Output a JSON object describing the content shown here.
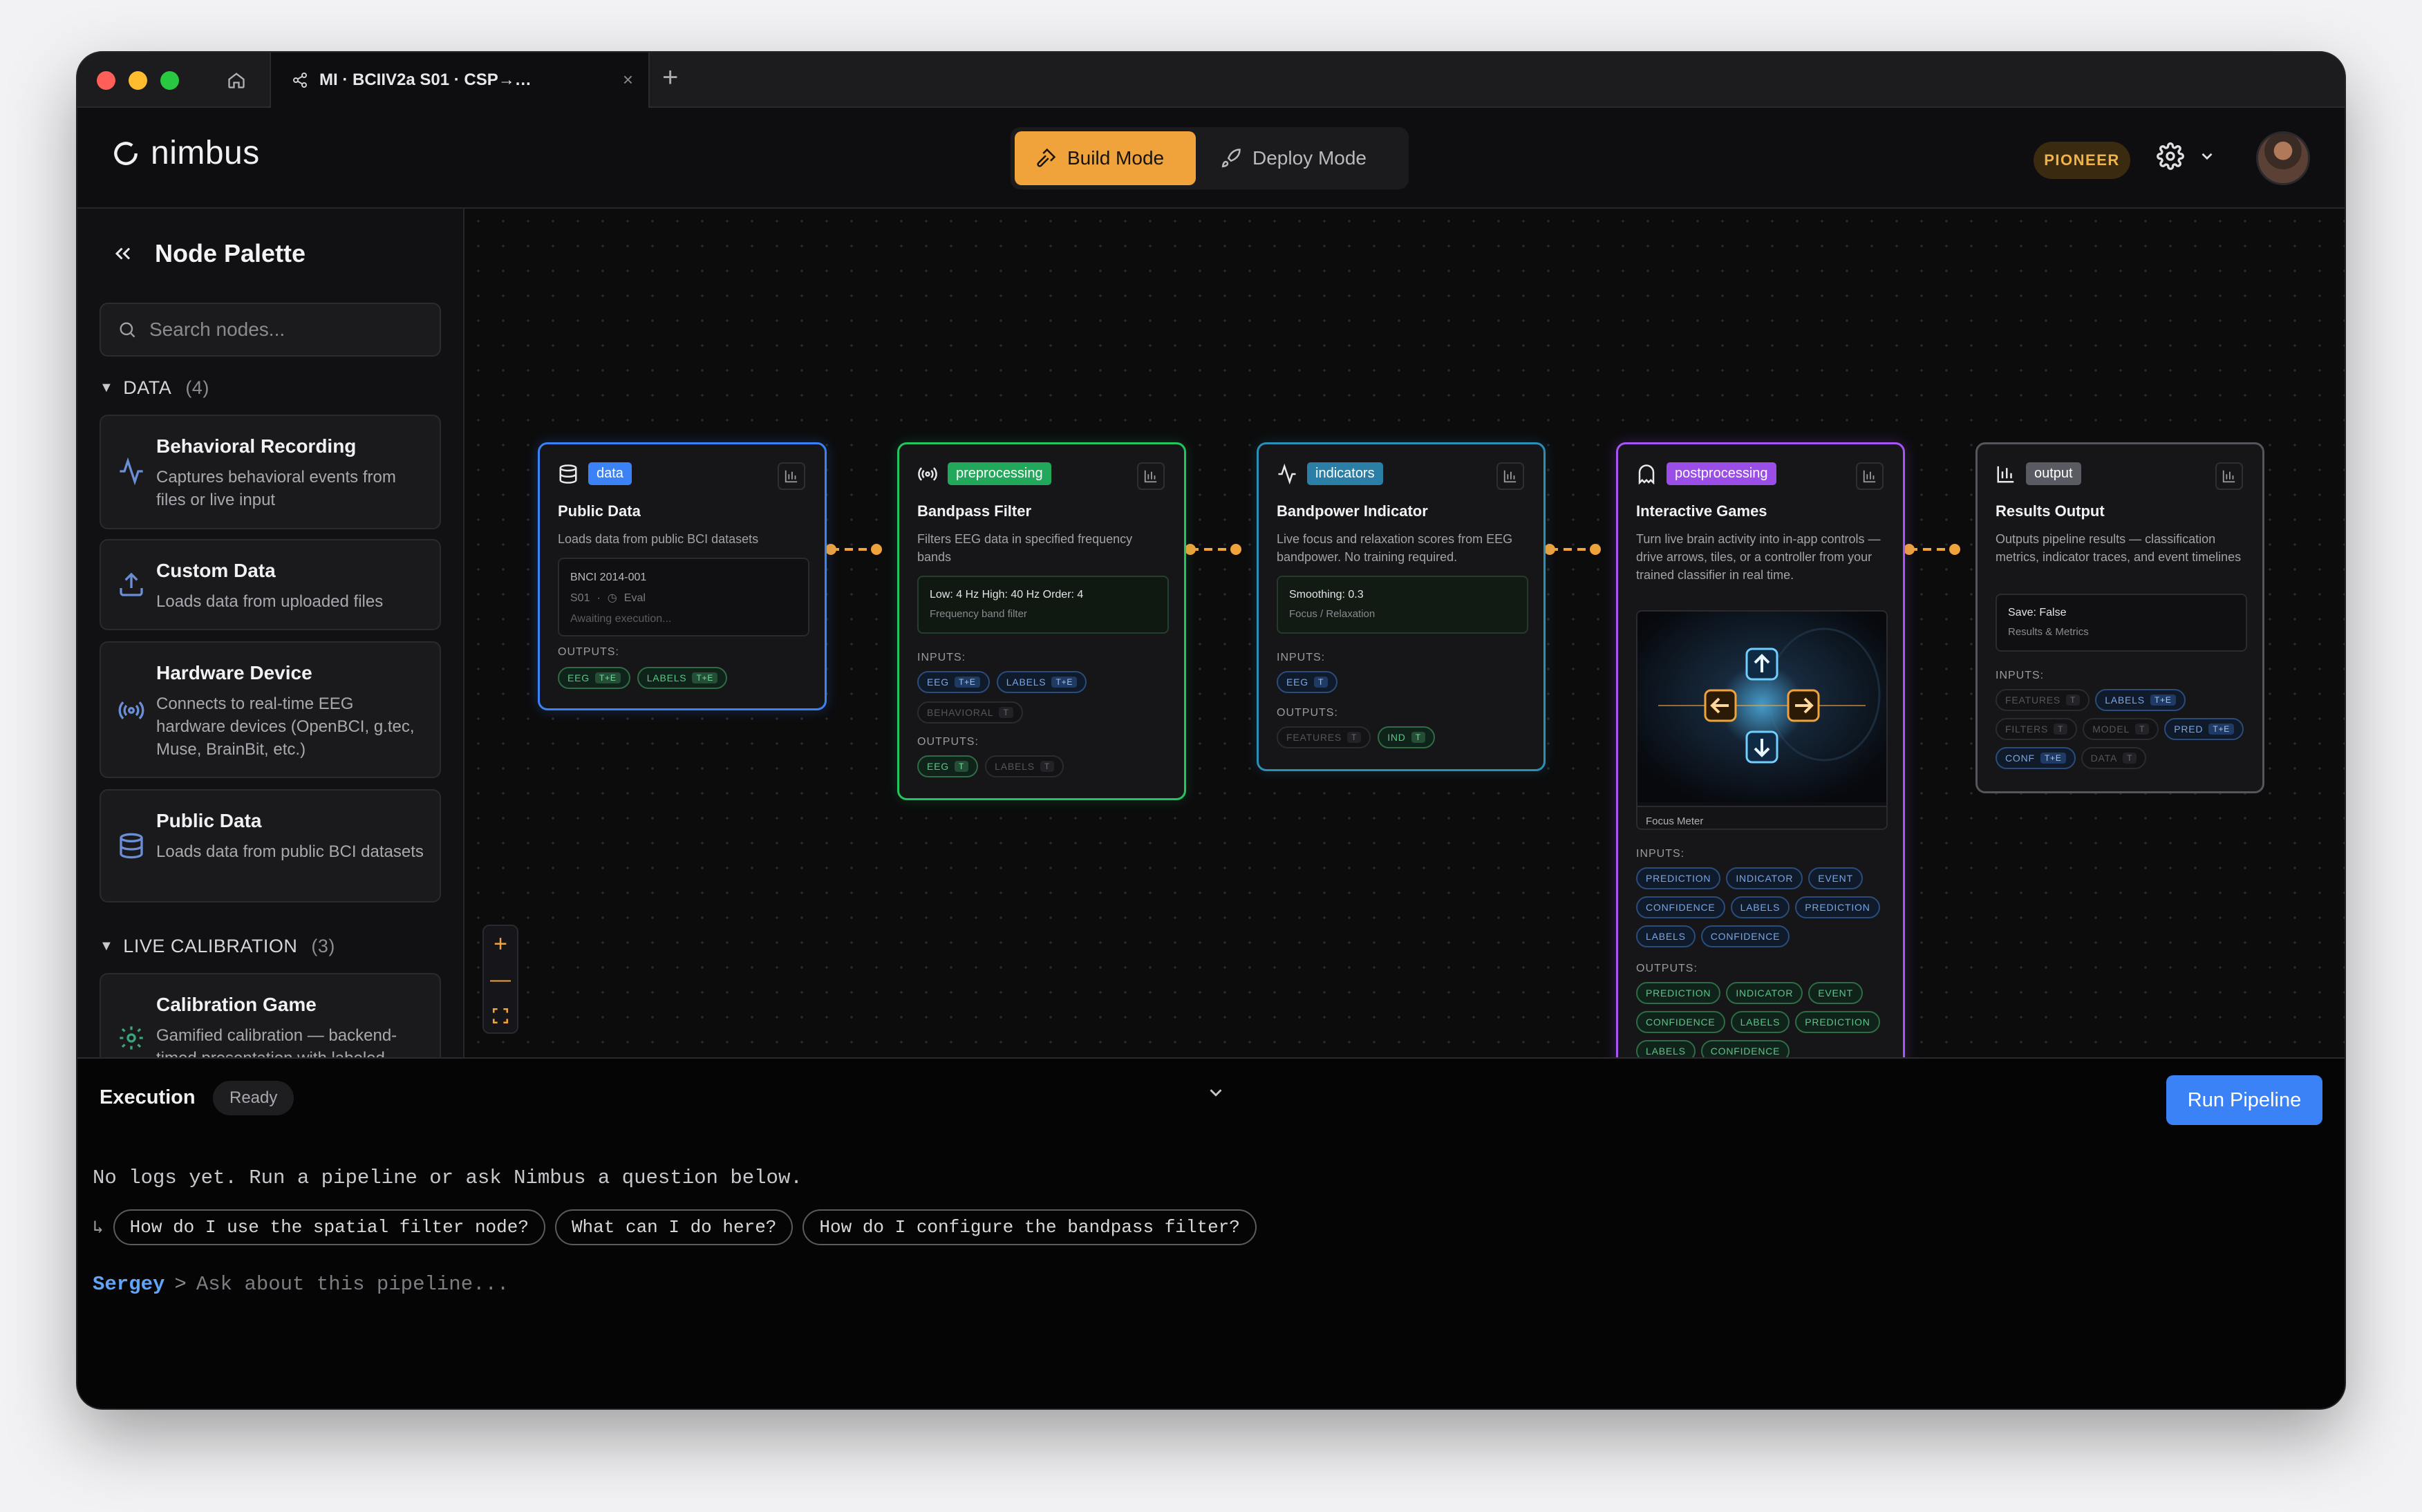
{
  "window": {
    "tab_title": "MI · BCIIV2a S01 · CSP→…"
  },
  "header": {
    "app_name": "nimbus",
    "modes": [
      {
        "label": "Build Mode",
        "active": true
      },
      {
        "label": "Deploy Mode",
        "active": false
      }
    ],
    "plan_badge": "PIONEER"
  },
  "sidebar": {
    "title": "Node Palette",
    "search_placeholder": "Search nodes...",
    "sections": [
      {
        "label": "DATA",
        "count": "(4)"
      },
      {
        "label": "LIVE CALIBRATION",
        "count": "(3)"
      }
    ],
    "items": [
      {
        "title": "Behavioral Recording",
        "desc": "Captures behavioral events from files or live input",
        "icon": "activity-icon"
      },
      {
        "title": "Custom Data",
        "desc": "Loads data from uploaded files",
        "icon": "upload-icon"
      },
      {
        "title": "Hardware Device",
        "desc": "Connects to real-time EEG hardware devices (OpenBCI, g.tec, Muse, BrainBit, etc.)",
        "icon": "broadcast-icon"
      },
      {
        "title": "Public Data",
        "desc": "Loads data from public BCI datasets",
        "icon": "database-icon"
      },
      {
        "title": "Calibration Game",
        "desc": "Gamified calibration — backend-timed presentation with labeled",
        "icon": "gamepad-icon"
      }
    ]
  },
  "nodes": [
    {
      "category": "data",
      "title": "Public Data",
      "desc": "Loads data from public BCI datasets",
      "box": {
        "line1": "BNCI 2014-001",
        "line2a": "S01",
        "line2b": "Eval",
        "line3": "Awaiting execution..."
      },
      "outputs_label": "OUTPUTS:",
      "outputs": [
        {
          "name": "EEG",
          "tag": "T+E"
        },
        {
          "name": "LABELS",
          "tag": "T+E"
        }
      ]
    },
    {
      "category": "preprocessing",
      "title": "Bandpass Filter",
      "desc": "Filters EEG data in specified frequency bands",
      "box": {
        "line1": "Low: 4 Hz   High: 40 Hz   Order: 4",
        "line2": "Frequency band filter"
      },
      "inputs_label": "INPUTS:",
      "inputs": [
        {
          "name": "EEG",
          "tag": "T+E"
        },
        {
          "name": "LABELS",
          "tag": "T+E"
        },
        {
          "name": "BEHAVIORAL",
          "tag": "T"
        }
      ],
      "outputs_label": "OUTPUTS:",
      "outputs": [
        {
          "name": "EEG",
          "tag": "T"
        },
        {
          "name": "LABELS",
          "tag": "T"
        }
      ]
    },
    {
      "category": "indicators",
      "title": "Bandpower Indicator",
      "desc": "Live focus and relaxation scores from EEG bandpower. No training required.",
      "box": {
        "line1": "Smoothing: 0.3",
        "line2": "Focus / Relaxation"
      },
      "inputs_label": "INPUTS:",
      "inputs": [
        {
          "name": "EEG",
          "tag": "T"
        }
      ],
      "outputs_label": "OUTPUTS:",
      "outputs": [
        {
          "name": "FEATURES",
          "tag": "T"
        },
        {
          "name": "IND",
          "tag": "T"
        }
      ]
    },
    {
      "category": "postprocessing",
      "title": "Interactive Games",
      "desc": "Turn live brain activity into in-app controls — drive arrows, tiles, or a controller from your trained classifier in real time.",
      "image_caption": "Focus Meter",
      "inputs_label": "INPUTS:",
      "inputs": [
        "PREDICTION",
        "INDICATOR",
        "EVENT",
        "CONFIDENCE",
        "LABELS",
        "PREDICTION",
        "LABELS",
        "CONFIDENCE"
      ],
      "outputs_label": "OUTPUTS:",
      "outputs": [
        "PREDICTION",
        "INDICATOR",
        "EVENT",
        "CONFIDENCE",
        "LABELS",
        "PREDICTION",
        "LABELS",
        "CONFIDENCE"
      ]
    },
    {
      "category": "output",
      "title": "Results Output",
      "desc": "Outputs pipeline results — classification metrics, indicator traces, and event timelines",
      "box": {
        "line1": "Save: False",
        "line2": "Results & Metrics"
      },
      "inputs_label": "INPUTS:",
      "inputs": [
        {
          "name": "FEATURES",
          "tag": "T"
        },
        {
          "name": "LABELS",
          "tag": "T+E"
        },
        {
          "name": "FILTERS",
          "tag": "T"
        },
        {
          "name": "MODEL",
          "tag": "T"
        },
        {
          "name": "PRED",
          "tag": "T+E"
        },
        {
          "name": "CONF",
          "tag": "T+E"
        },
        {
          "name": "DATA",
          "tag": "T"
        }
      ]
    }
  ],
  "colors": {
    "accent": "#f0a33a",
    "data": "#3b82f6",
    "preprocessing": "#22c55e",
    "indicators": "#2b8fb8",
    "postprocessing": "#a855f7",
    "output": "#6b7280",
    "run": "#3b82f6"
  },
  "bottom": {
    "title": "Execution",
    "status": "Ready",
    "run_label": "Run Pipeline",
    "log": "No logs yet. Run a pipeline or ask Nimbus a question below.",
    "suggestion_arrow": "↳",
    "suggestions": [
      "How do I use the spatial filter node?",
      "What can I do here?",
      "How do I configure the bandpass filter?"
    ],
    "user": "Sergey",
    "prompt_symbol": ">",
    "prompt_placeholder": "Ask about this pipeline..."
  }
}
